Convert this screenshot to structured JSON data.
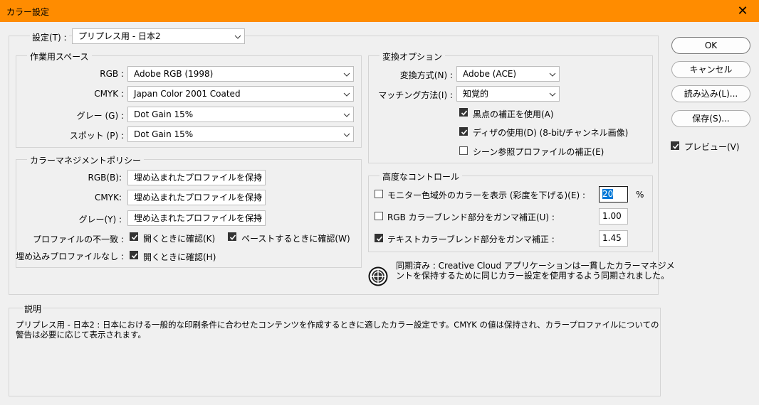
{
  "window": {
    "title": "カラー設定",
    "close_glyph": "✕"
  },
  "settings": {
    "label": "設定(T) :",
    "value": "プリプレス用 - 日本2"
  },
  "working_spaces": {
    "title": "作業用スペース",
    "rows": [
      {
        "label": "RGB :",
        "value": "Adobe RGB (1998)"
      },
      {
        "label": "CMYK :",
        "value": "Japan Color 2001 Coated"
      },
      {
        "label": "グレー (G) :",
        "value": "Dot Gain 15%"
      },
      {
        "label": "スポット (P) :",
        "value": "Dot Gain 15%"
      }
    ]
  },
  "color_management": {
    "title": "カラーマネジメントポリシー",
    "rows": [
      {
        "label": "RGB(B):",
        "value": "埋め込まれたプロファイルを保持"
      },
      {
        "label": "CMYK:",
        "value": "埋め込まれたプロファイルを保持"
      },
      {
        "label": "グレー(Y) :",
        "value": "埋め込まれたプロファイルを保持"
      }
    ],
    "mismatch_label": "プロファイルの不一致 :",
    "mismatch_open": "開くときに確認(K)",
    "mismatch_paste": "ペーストするときに確認(W)",
    "missing_label": "埋め込みプロファイルなし :",
    "missing_open": "開くときに確認(H)"
  },
  "conversion": {
    "title": "変換オプション",
    "engine_label": "変換方式(N) :",
    "engine_value": "Adobe (ACE)",
    "intent_label": "マッチング方法(I) :",
    "intent_value": "知覚的",
    "blackpoint": "黒点の補正を使用(A)",
    "dither": "ディザの使用(D) (8-bit/チャンネル画像)",
    "scene_ref": "シーン参照プロファイルの補正(E)"
  },
  "advanced": {
    "title": "高度なコントロール",
    "desaturate": "モニター色域外のカラーを表示 (彩度を下げる)(E) :",
    "desaturate_value": "20",
    "percent": "%",
    "blend_rgb": "RGB カラーブレンド部分をガンマ補正(U) :",
    "blend_rgb_value": "1.00",
    "blend_text": "テキストカラーブレンド部分をガンマ補正 :",
    "blend_text_value": "1.45"
  },
  "sync": {
    "line1": "同期済み : Creative Cloud アプリケーションは一貫したカラーマネジメ",
    "line2": "ントを保持するために同じカラー設定を使用するよう同期されました。"
  },
  "buttons": {
    "ok": "OK",
    "cancel": "キャンセル",
    "load": "読み込み(L)...",
    "save": "保存(S)...",
    "preview": "プレビュー(V)"
  },
  "description": {
    "title": "説明",
    "line1": "プリプレス用 - 日本2 : 日本における一般的な印刷条件に合わせたコンテンツを作成するときに適したカラー設定です。CMYK の値は保持され、カラープロファイルについての",
    "line2": "警告は必要に応じて表示されます。"
  },
  "colors": {
    "titlebar": "#ff8c00",
    "selection": "#0078d7",
    "background": "#f0f0f0"
  }
}
